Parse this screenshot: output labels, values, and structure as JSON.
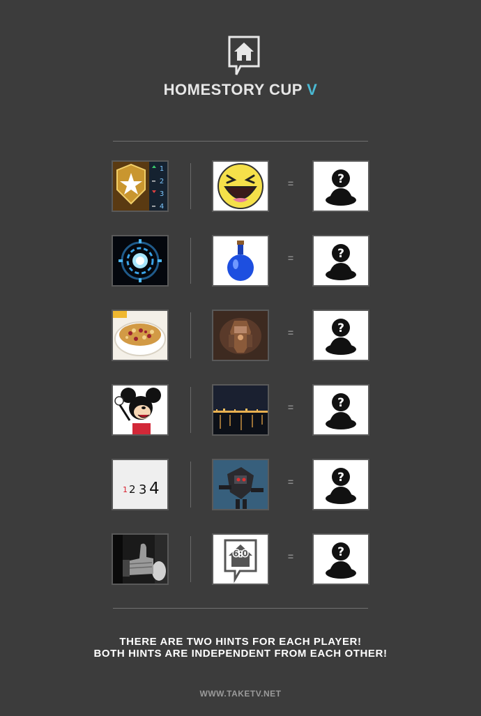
{
  "header": {
    "title": "HOMESTORY CUP",
    "title_suffix": "V",
    "accent": "#4ab9d3"
  },
  "rows": [
    {
      "hint1": "rank-badge-icon",
      "hint2": "laughing-smiley-icon",
      "equals": "=",
      "answer": "mystery-player-icon"
    },
    {
      "hint1": "arc-reactor-icon",
      "hint2": "blue-potion-icon",
      "equals": "=",
      "answer": "mystery-player-icon"
    },
    {
      "hint1": "cereal-bowl-icon",
      "hint2": "armored-creature-icon",
      "equals": "=",
      "answer": "mystery-player-icon"
    },
    {
      "hint1": "mickey-mouse-icon",
      "hint2": "night-harbor-icon",
      "equals": "=",
      "answer": "mystery-player-icon"
    },
    {
      "hint1": "numbers-1234",
      "hint2": "mech-robot-icon",
      "equals": "=",
      "answer": "mystery-player-icon"
    },
    {
      "hint1": "thumbs-up-photo-icon",
      "hint2": "homestory-score-icon",
      "equals": "=",
      "answer": "mystery-player-icon"
    }
  ],
  "hints_text": {
    "rank_numbers": [
      "1",
      "2",
      "3",
      "4"
    ],
    "sequence": [
      "1",
      "2",
      "3",
      "4"
    ],
    "score": "6:0"
  },
  "footer": {
    "line1": "THERE ARE TWO HINTS FOR EACH PLAYER!",
    "line2": "BOTH HINTS ARE INDEPENDENT FROM EACH OTHER!"
  },
  "website": "WWW.TAKETV.NET"
}
